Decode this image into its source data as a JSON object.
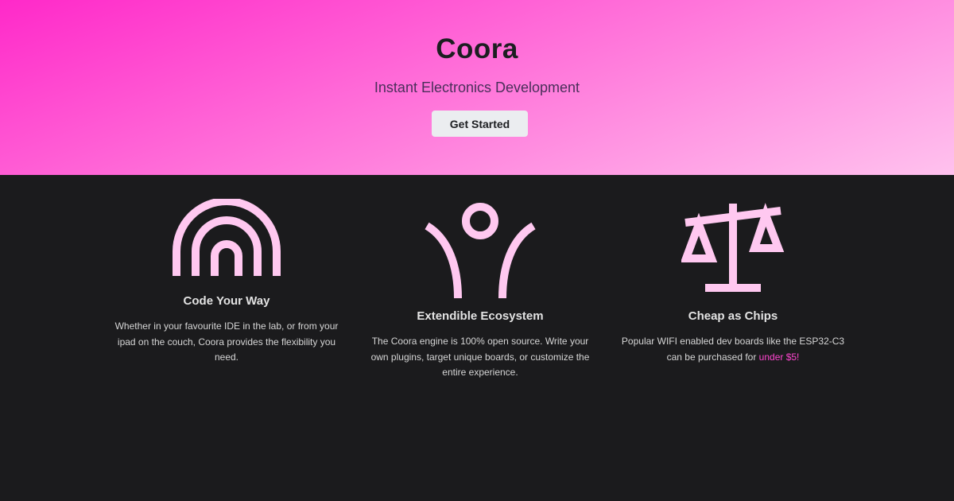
{
  "hero": {
    "title": "Coora",
    "subtitle": "Instant Electronics Development",
    "cta_label": "Get Started"
  },
  "features": [
    {
      "icon": "rainbow-arch-icon",
      "title": "Code Your Way",
      "text": "Whether in your favourite IDE in the lab, or from your ipad on the couch, Coora provides the flexibility you need."
    },
    {
      "icon": "person-arms-up-icon",
      "title": "Extendible Ecosystem",
      "text": "The Coora engine is 100% open source. Write your own plugins, target unique boards, or customize the entire experience."
    },
    {
      "icon": "scales-icon",
      "title": "Cheap as Chips",
      "text_before": "Popular WIFI enabled dev boards like the ESP32-C3 can be purchased for ",
      "text_highlight": "under $5!"
    }
  ],
  "colors": {
    "hero_gradient_start": "#ff29c9",
    "hero_gradient_end": "#ffc2ee",
    "background": "#1b1b1d",
    "icon": "#ffc8f0",
    "accent": "#ff45cf"
  }
}
